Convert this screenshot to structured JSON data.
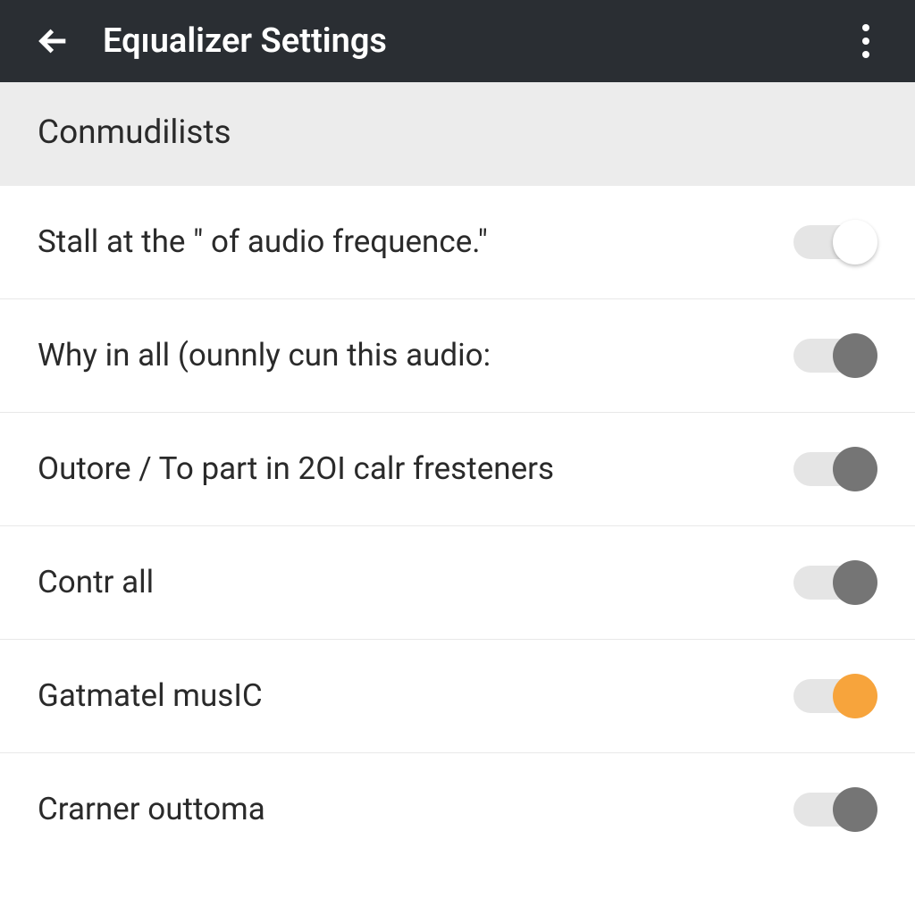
{
  "header": {
    "title": "Eqıualizer Settings"
  },
  "section": {
    "title": "Conmudilists"
  },
  "items": [
    {
      "label": "Stall at the \" of audio frequence.\"",
      "thumbColor": "white"
    },
    {
      "label": "Why in all (ounnly cun this audio:",
      "thumbColor": "gray"
    },
    {
      "label": "Outore / To part in 2OI calr fresteners",
      "thumbColor": "gray"
    },
    {
      "label": "Contr all",
      "thumbColor": "gray"
    },
    {
      "label": "Gatmatel musIC",
      "thumbColor": "orange"
    },
    {
      "label": "Crarner outtoma",
      "thumbColor": "gray"
    }
  ],
  "colors": {
    "appBar": "#2a2e33",
    "accent": "#f7a43c",
    "grayThumb": "#757575",
    "track": "#e5e5e5"
  }
}
